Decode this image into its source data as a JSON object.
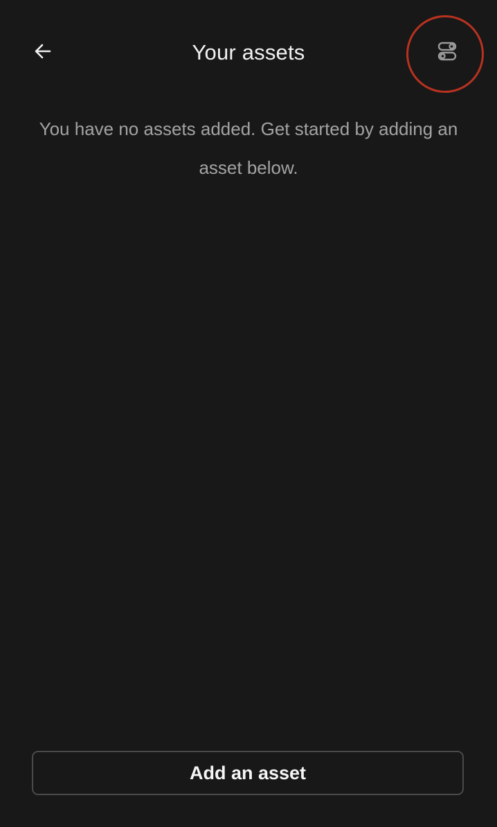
{
  "header": {
    "title": "Your assets",
    "back_icon": "arrow-left-icon",
    "filter_icon": "toggle-settings-icon"
  },
  "main": {
    "empty_message": "You have no assets added. Get started by adding an asset below."
  },
  "footer": {
    "add_button_label": "Add an asset"
  },
  "colors": {
    "background": "#181818",
    "title_text": "#f2f2f2",
    "secondary_text": "#a3a3a3",
    "button_border": "#4a4a4a",
    "highlight_ring": "#b8321f"
  }
}
